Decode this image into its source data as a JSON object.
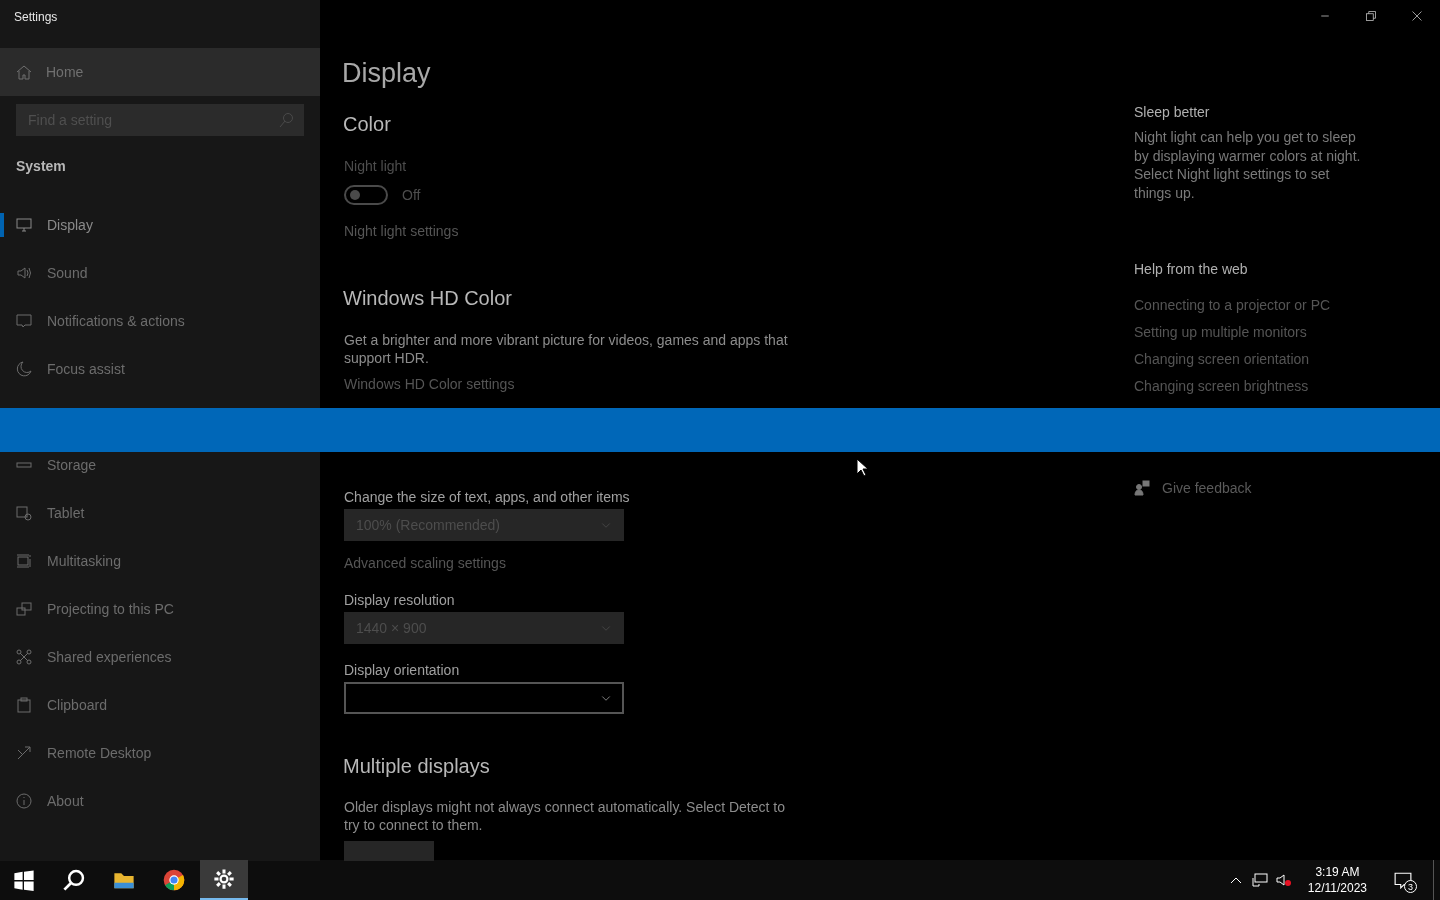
{
  "window": {
    "title": "Settings"
  },
  "sidebar": {
    "home": {
      "label": "Home"
    },
    "search": {
      "placeholder": "Find a setting"
    },
    "section": "System",
    "items": [
      {
        "label": "Display",
        "selected": true
      },
      {
        "label": "Sound",
        "selected": false
      },
      {
        "label": "Notifications & actions",
        "selected": false
      },
      {
        "label": "Focus assist",
        "selected": false
      },
      {
        "label": "Storage",
        "selected": false
      },
      {
        "label": "Tablet",
        "selected": false
      },
      {
        "label": "Multitasking",
        "selected": false
      },
      {
        "label": "Projecting to this PC",
        "selected": false
      },
      {
        "label": "Shared experiences",
        "selected": false
      },
      {
        "label": "Clipboard",
        "selected": false
      },
      {
        "label": "Remote Desktop",
        "selected": false
      },
      {
        "label": "About",
        "selected": false
      }
    ]
  },
  "page": {
    "title": "Display",
    "color": {
      "heading": "Color",
      "night_light": {
        "label": "Night light",
        "on": false,
        "state_text": "Off",
        "link": "Night light settings"
      }
    },
    "hdr": {
      "heading": "Windows HD Color",
      "description": "Get a brighter and more vibrant picture for videos, games and apps that support HDR.",
      "link": "Windows HD Color settings"
    },
    "scale": {
      "size_label": "Change the size of text, apps, and other items",
      "size": {
        "value": "100% (Recommended)",
        "disabled": true
      },
      "advanced_link": "Advanced scaling settings",
      "resolution_label": "Display resolution",
      "resolution": {
        "value": "1440 × 900",
        "disabled": true
      },
      "orientation_label": "Display orientation",
      "orientation": {
        "disabled": false
      }
    },
    "multiple": {
      "heading": "Multiple displays",
      "description": "Older displays might not always connect automatically. Select Detect to try to connect to them."
    }
  },
  "aside": {
    "sleep": {
      "heading": "Sleep better",
      "text": "Night light can help you get to sleep by displaying warmer colors at night. Select Night light settings to set things up."
    },
    "help": {
      "heading": "Help from the web",
      "links": [
        "Connecting to a projector or PC",
        "Setting up multiple monitors",
        "Changing screen orientation",
        "Changing screen brightness"
      ]
    },
    "feedback": {
      "label": "Give feedback"
    }
  },
  "taskbar": {
    "apps": [
      {
        "selected": false
      },
      {
        "selected": false
      },
      {
        "selected": false
      },
      {
        "selected": false
      },
      {
        "selected": true
      }
    ],
    "time": "3:19 AM",
    "date": "12/11/2023",
    "notifications": "3"
  }
}
